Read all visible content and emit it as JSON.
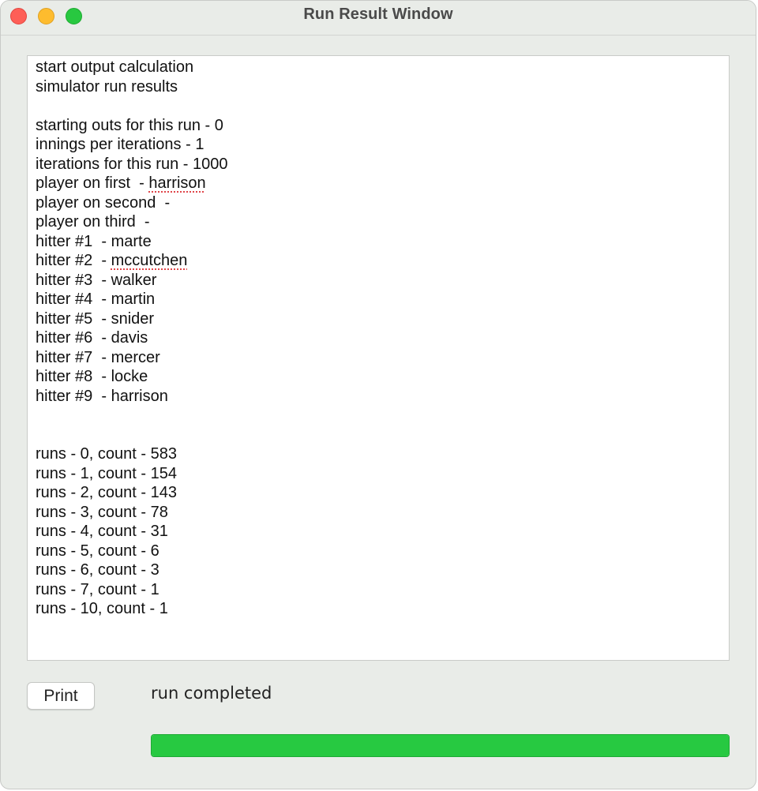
{
  "window": {
    "title": "Run Result Window"
  },
  "output": {
    "lines": [
      {
        "text": "start output calculation"
      },
      {
        "text": "simulator run results"
      },
      {
        "text": ""
      },
      {
        "text": "starting outs for this run - 0"
      },
      {
        "text": "innings per iterations - 1"
      },
      {
        "text": "iterations for this run - 1000"
      },
      {
        "prefix": "player on first  - ",
        "flagged": "harrison"
      },
      {
        "text": "player on second  -"
      },
      {
        "text": "player on third  -"
      },
      {
        "text": "hitter #1  - marte"
      },
      {
        "prefix": "hitter #2  - ",
        "flagged": "mccutchen"
      },
      {
        "text": "hitter #3  - walker"
      },
      {
        "text": "hitter #4  - martin"
      },
      {
        "text": "hitter #5  - snider"
      },
      {
        "text": "hitter #6  - davis"
      },
      {
        "text": "hitter #7  - mercer"
      },
      {
        "text": "hitter #8  - locke"
      },
      {
        "text": "hitter #9  - harrison"
      },
      {
        "text": ""
      },
      {
        "text": ""
      },
      {
        "text": "runs - 0, count - 583"
      },
      {
        "text": "runs - 1, count - 154"
      },
      {
        "text": "runs - 2, count - 143"
      },
      {
        "text": "runs - 3, count - 78"
      },
      {
        "text": "runs - 4, count - 31"
      },
      {
        "text": "runs - 5, count - 6"
      },
      {
        "text": "runs - 6, count - 3"
      },
      {
        "text": "runs - 7, count - 1"
      },
      {
        "text": "runs - 10, count - 1"
      }
    ]
  },
  "controls": {
    "print_label": "Print",
    "status_text": "run completed",
    "progress_percent": 100
  },
  "colors": {
    "window_bg": "#e9ece8",
    "progress_fill": "#27c941",
    "close_button": "#fe5f57",
    "minimize_button": "#febc2e",
    "zoom_button": "#28c840",
    "spellcheck_underline": "#e0464a"
  }
}
